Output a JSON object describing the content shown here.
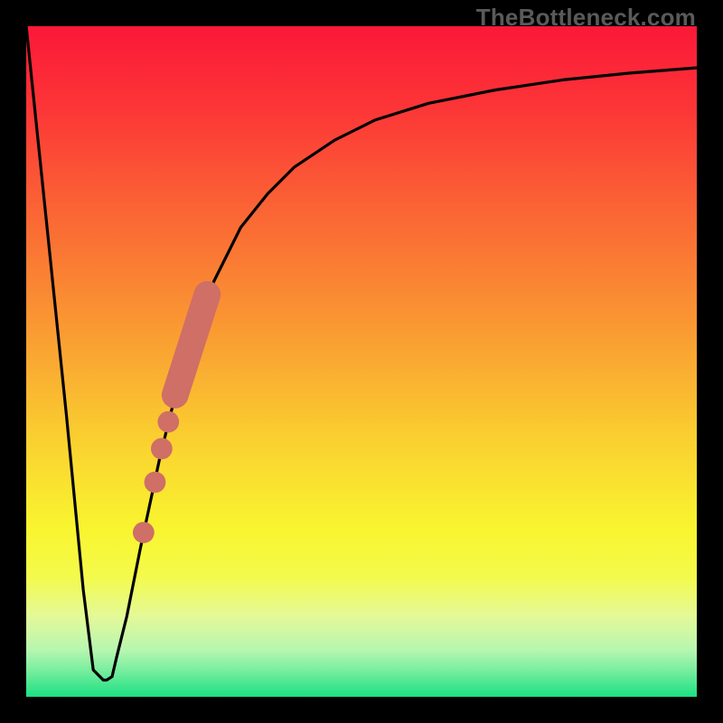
{
  "watermark": "TheBottleneck.com",
  "colors": {
    "bg": "#000000",
    "curve": "#000000",
    "markers": "#cf6f66",
    "gradient_stops": [
      {
        "offset": 0.0,
        "color": "#fb1838"
      },
      {
        "offset": 0.12,
        "color": "#fc3537"
      },
      {
        "offset": 0.25,
        "color": "#fb5d35"
      },
      {
        "offset": 0.38,
        "color": "#fa8433"
      },
      {
        "offset": 0.5,
        "color": "#faa932"
      },
      {
        "offset": 0.62,
        "color": "#fad130"
      },
      {
        "offset": 0.75,
        "color": "#f9f52f"
      },
      {
        "offset": 0.82,
        "color": "#f4fa4b"
      },
      {
        "offset": 0.88,
        "color": "#e4f998"
      },
      {
        "offset": 0.93,
        "color": "#b7f6b0"
      },
      {
        "offset": 0.96,
        "color": "#7aee9f"
      },
      {
        "offset": 1.0,
        "color": "#1be083"
      }
    ]
  },
  "chart_data": {
    "type": "line",
    "title": "",
    "xlabel": "",
    "ylabel": "",
    "xlim": [
      0,
      100
    ],
    "ylim": [
      0,
      100
    ],
    "annotations": [
      "TheBottleneck.com"
    ],
    "series": [
      {
        "name": "curve",
        "x": [
          0,
          3,
          6,
          8.5,
          10,
          11.5,
          12,
          12.8,
          13.5,
          15,
          17,
          20,
          22,
          25,
          28,
          32,
          36,
          40,
          46,
          52,
          60,
          70,
          80,
          90,
          100
        ],
        "y": [
          100,
          71,
          42,
          16,
          4,
          2.5,
          2.5,
          3,
          6,
          12,
          22,
          36,
          44,
          54,
          62,
          70,
          75,
          79,
          83,
          86,
          88.5,
          90.5,
          92,
          93,
          93.8
        ]
      },
      {
        "name": "markers",
        "points": [
          {
            "x": 17.5,
            "y": 24.5,
            "r": 1.6
          },
          {
            "x": 19.2,
            "y": 32.0,
            "r": 1.6
          },
          {
            "x": 20.2,
            "y": 37.0,
            "r": 1.6
          },
          {
            "x": 21.2,
            "y": 41.0,
            "r": 1.6
          }
        ],
        "thick_segment": {
          "x0": 22.2,
          "y0": 45.0,
          "x1": 27.0,
          "y1": 60.0,
          "r": 2.0
        }
      }
    ]
  }
}
